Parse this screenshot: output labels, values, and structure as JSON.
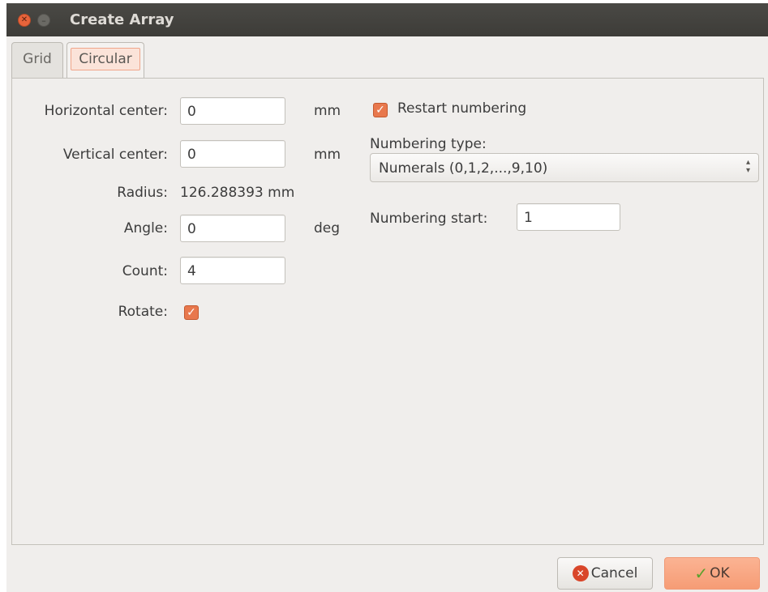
{
  "window": {
    "title": "Create Array"
  },
  "tabs": [
    {
      "label": "Grid",
      "active": false
    },
    {
      "label": "Circular",
      "active": true
    }
  ],
  "form": {
    "horizontal_center": {
      "label": "Horizontal center:",
      "value": "0",
      "unit": "mm"
    },
    "vertical_center": {
      "label": "Vertical center:",
      "value": "0",
      "unit": "mm"
    },
    "radius": {
      "label": "Radius:",
      "value": "126.288393 mm"
    },
    "angle": {
      "label": "Angle:",
      "value": "0",
      "unit": "deg"
    },
    "count": {
      "label": "Count:",
      "value": "4"
    },
    "rotate": {
      "label": "Rotate:",
      "checked": true
    }
  },
  "numbering": {
    "restart_label": "Restart numbering",
    "restart_checked": true,
    "type_label": "Numbering type:",
    "type_value": "Numerals (0,1,2,...,9,10)",
    "start_label": "Numbering start:",
    "start_value": "1"
  },
  "buttons": {
    "cancel": "Cancel",
    "ok": "OK"
  },
  "icons": {
    "close": "close-icon",
    "minimize": "minimize-icon",
    "checkbox": "checkmark-icon",
    "select": "updown-arrows-icon",
    "cancel": "cancel-icon",
    "ok": "checkmark-icon"
  },
  "colors": {
    "accent": "#e8784d",
    "titlebar": "#3d3c38",
    "background": "#f0eeec"
  }
}
